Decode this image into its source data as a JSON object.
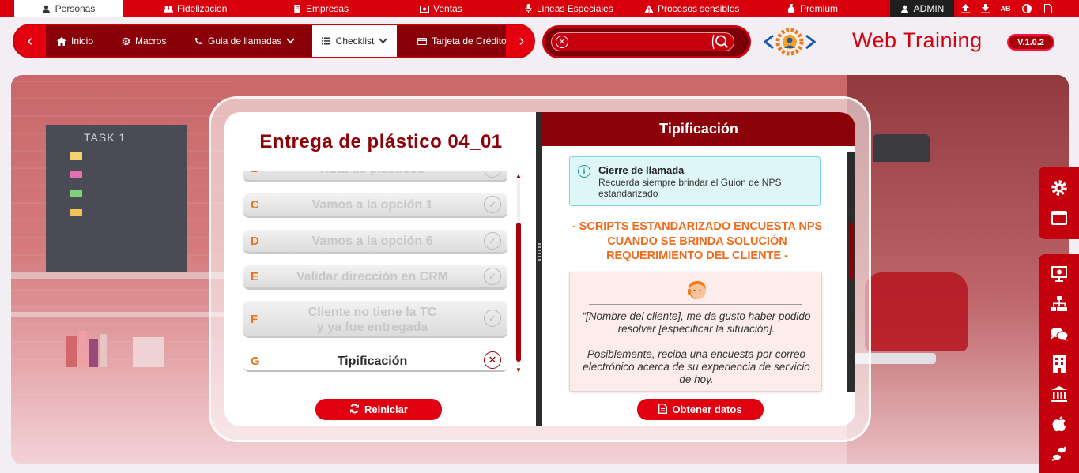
{
  "topbar": {
    "tabs": [
      {
        "label": "Personas",
        "icon": "user-icon"
      },
      {
        "label": "Fidelizacion",
        "icon": "users-icon"
      },
      {
        "label": "Empresas",
        "icon": "building-icon"
      },
      {
        "label": "Ventas",
        "icon": "money-icon"
      },
      {
        "label": "Lineas Especiales",
        "icon": "microphone-icon"
      },
      {
        "label": "Procesos sensibles",
        "icon": "warning-icon"
      },
      {
        "label": "Premium",
        "icon": "moneybag-icon"
      }
    ],
    "admin_label": "ADMIN",
    "tool_icons": [
      "upload-icon",
      "download-icon",
      "spellcheck-icon",
      "contrast-icon",
      "document-icon"
    ]
  },
  "nav": {
    "items": [
      {
        "label": "Inicio",
        "icon": "home-icon"
      },
      {
        "label": "Macros",
        "icon": "gear-icon"
      },
      {
        "label": "Guia de llamadas",
        "icon": "phone-icon"
      },
      {
        "label": "Checklist",
        "icon": "list-icon"
      },
      {
        "label": "Tarjeta de Crédito",
        "icon": "card-icon"
      }
    ],
    "active": "Checklist"
  },
  "search": {
    "placeholder": ""
  },
  "brand": {
    "title": "Web Training",
    "version": "V.1.0.2"
  },
  "scene": {
    "board_text": "TASK 1"
  },
  "checklist": {
    "title": "Entrega de plástico 04_01",
    "steps": [
      {
        "letter": "B",
        "label": "Ruta de plásticos",
        "done": true
      },
      {
        "letter": "C",
        "label": "Vamos a la opción 1",
        "done": true
      },
      {
        "letter": "D",
        "label": "Vamos a la opción 6",
        "done": true
      },
      {
        "letter": "E",
        "label": "Validar dirección en CRM",
        "done": true
      },
      {
        "letter": "F",
        "label": "Cliente no tiene la TC\ny ya fue entregada",
        "done": true
      },
      {
        "letter": "G",
        "label": "Tipificación",
        "done": false
      }
    ],
    "reset_label": "Reiniciar",
    "get_data_label": "Obtener datos"
  },
  "detail": {
    "header": "Tipificación",
    "info_title": "Cierre de llamada",
    "info_text": "Recuerda siempre brindar el Guion de NPS estandarizado",
    "script_heading": "- SCRIPTS ESTANDARIZADO ENCUESTA NPS CUANDO SE BRINDA SOLUCIÓN REQUERIMIENTO DEL CLIENTE -",
    "quote_text": "“[Nombre del cliente], me da gusto haber podido resolver [especificar la situación].\n\nPosiblemente, reciba una encuesta por correo electrónico acerca de su experiencia de servicio de hoy."
  },
  "dock": {
    "top": [
      "settings-icon",
      "window-icon"
    ],
    "bottom": [
      "presentation-icon",
      "sitemap-icon",
      "chat-icon",
      "building-icon",
      "bank-icon",
      "apple-icon",
      "footsteps-icon"
    ]
  },
  "colors": {
    "primary": "#d9000e",
    "dark_red": "#8c0008",
    "orange": "#f06a1c",
    "info_bg": "#dff6f8"
  }
}
